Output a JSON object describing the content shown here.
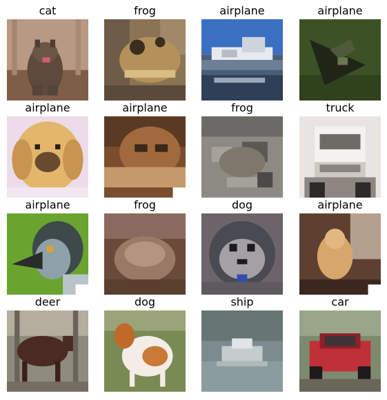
{
  "images": [
    {
      "label": "cat"
    },
    {
      "label": "frog"
    },
    {
      "label": "airplane"
    },
    {
      "label": "airplane"
    },
    {
      "label": "airplane"
    },
    {
      "label": "airplane"
    },
    {
      "label": "frog"
    },
    {
      "label": "truck"
    },
    {
      "label": "airplane"
    },
    {
      "label": "frog"
    },
    {
      "label": "dog"
    },
    {
      "label": "airplane"
    },
    {
      "label": "deer"
    },
    {
      "label": "dog"
    },
    {
      "label": "ship"
    },
    {
      "label": "car"
    }
  ]
}
